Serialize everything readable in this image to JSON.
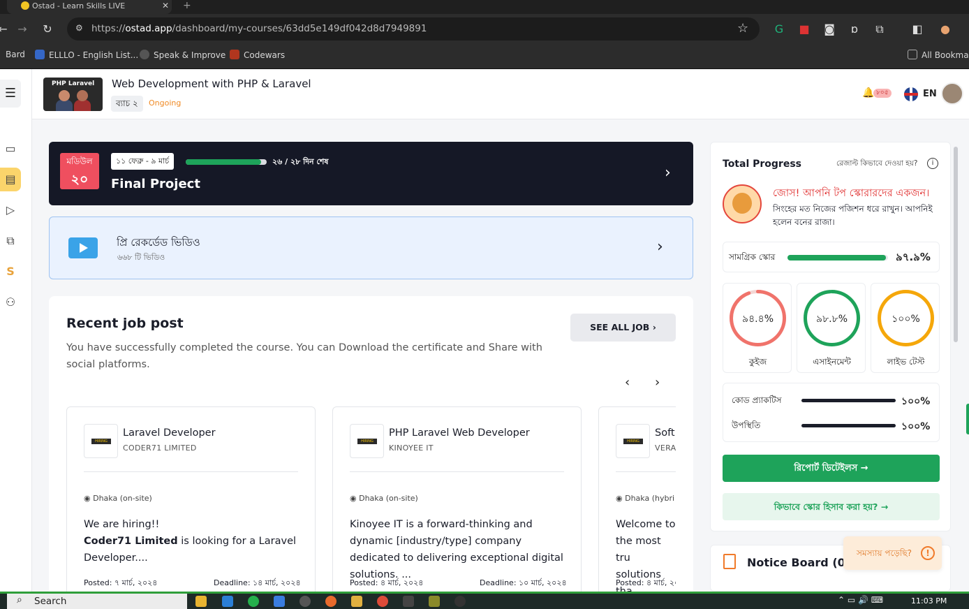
{
  "browser": {
    "tab_title": "Ostad - Learn Skills LIVE",
    "url_prefix": "https://",
    "url_host": "ostad.app",
    "url_path": "/dashboard/my-courses/63dd5e149df042d8d7949891",
    "bookmarks": [
      "Bard",
      "ELLLO - English List...",
      "Speak & Improve",
      "Codewars",
      "All Bookmarks"
    ]
  },
  "header": {
    "thumb_label": "PHP Laravel",
    "course_title": "Web Development with PHP & Laravel",
    "batch": "ব্যাচ ২",
    "status": "Ongoing",
    "notification_count": "৮০৫",
    "language": "EN"
  },
  "module": {
    "badge_label": "মডিউল",
    "badge_number": "২০",
    "date_range": "১১ ফেব্রু - ৯ মার্চ",
    "progress": 0.93,
    "days_left": "২৬ / ২৮ দিন শেষ",
    "title": "Final Project"
  },
  "videos": {
    "title": "প্রি রেকর্ডেড ভিডিও",
    "count": "৬৬৮ টি ভিডিও"
  },
  "jobs": {
    "title": "Recent job post",
    "description": "You have successfully completed the course. You can Download the certificate and Share with social platforms.",
    "see_all": "SEE ALL JOB",
    "cards": [
      {
        "role": "Laravel Developer",
        "company": "CODER71 LIMITED",
        "location": "Dhaka (on-site)",
        "desc_line1": "We are hiring!!",
        "desc_bold": "Coder71 Limited",
        "desc_rest": " is looking for a Laravel Developer....",
        "posted": "Posted: ৭ মার্চ, ২০২৪",
        "deadline": "Deadline: ১৪ মার্চ, ২০২৪"
      },
      {
        "role": "PHP Laravel Web Developer",
        "company": "KINOYEE IT",
        "location": "Dhaka (on-site)",
        "desc": "Kinoyee IT is a forward-thinking and dynamic [industry/type] company dedicated to delivering exceptional digital solutions. ...",
        "posted": "Posted: ৪ মার্চ, ২০২৪",
        "deadline": "Deadline: ১০ মার্চ, ২০২৪"
      },
      {
        "role": "Soft",
        "company": "VERA",
        "location": "Dhaka (hybri",
        "desc": "Welcome to the most tru solutions tha",
        "posted": "Posted: ৪ মার্চ, ২০"
      }
    ]
  },
  "progress": {
    "title": "Total Progress",
    "result_link": "রেজাল্ট কিভাবে দেওয়া হয়?",
    "congrats": "জোস! আপনি টপ স্কোরারদের একজন।",
    "message": "সিংহের মত নিজের পজিশন ধরে রাখুন। আপনিই হলেন বনের রাজা।",
    "overall_label": "সামগ্রিক স্কোর",
    "overall_value": "৯৭.৯%",
    "overall_fraction": 0.979,
    "rings": [
      {
        "label": "কুইজ",
        "value": "৯৪.৪%",
        "fraction": 0.944,
        "color": "#f0736b"
      },
      {
        "label": "এসাইনমেন্ট",
        "value": "৯৮.৮%",
        "fraction": 0.988,
        "color": "#1ea35a"
      },
      {
        "label": "লাইভ টেস্ট",
        "value": "১০০%",
        "fraction": 1.0,
        "color": "#f5a70a"
      }
    ],
    "bars": [
      {
        "label": "কোড প্র্যাকটিস",
        "value": "১০০%",
        "fraction": 1.0
      },
      {
        "label": "উপস্থিতি",
        "value": "১০০%",
        "fraction": 1.0
      }
    ],
    "report_button": "রিপোর্ট ডিটেইলস  →",
    "how_button": "কিভাবে স্কোর হিসাব করা হয়?  →"
  },
  "notice": {
    "title": "Notice Board (0)"
  },
  "help": {
    "label": "সমস্যায় পড়েছি?"
  },
  "taskbar": {
    "search": "Search",
    "clock": "11:03 PM"
  },
  "colors": {
    "accent_green": "#1ea35a",
    "module_red": "#ef4f5f",
    "navy": "#151826",
    "orange": "#f07a2a"
  }
}
